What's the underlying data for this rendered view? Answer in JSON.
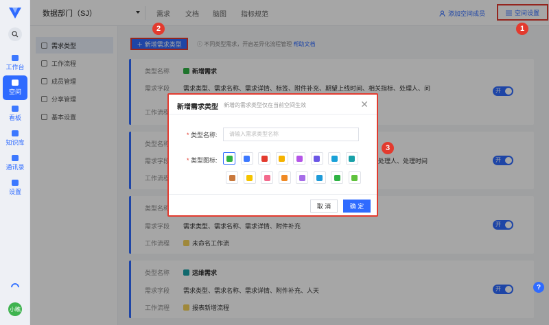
{
  "rail": {
    "items": [
      {
        "label": "工作台"
      },
      {
        "label": "空间"
      },
      {
        "label": "看板"
      },
      {
        "label": "知识库"
      },
      {
        "label": "通讯录"
      },
      {
        "label": "设置"
      }
    ],
    "avatar_text": "小瞧"
  },
  "header": {
    "department": "数据部门（SJ）",
    "tabs": [
      "需求",
      "文档",
      "脑图",
      "指标规范"
    ],
    "add_member": "添加空间成员",
    "space_settings": "空间设置"
  },
  "subnav": {
    "items": [
      "需求类型",
      "工作流程",
      "成员管理",
      "分享管理",
      "基本设置"
    ]
  },
  "toolbar": {
    "new_type_button": "新增需求类型",
    "hint": "不同类型需求，开启差异化流程管理",
    "help_link": "帮助文档"
  },
  "labels": {
    "type_name": "类型名称",
    "fields": "需求字段",
    "workflow": "工作流程",
    "toggle_on": "开"
  },
  "cards": [
    {
      "name": "新增需求",
      "fields": "需求类型、需求名称、需求详情、标签、附件补充、期望上线时间、相关指标、处理人、问",
      "workflow": "",
      "icon_color": "#2fb344"
    },
    {
      "name": "",
      "fields": "处理人、处理时间",
      "workflow": "",
      "icon_color": "#3c78ff"
    },
    {
      "name": "",
      "fields": "需求类型、需求名称、需求详情、附件补充",
      "workflow": "未命名工作流",
      "icon_color": "#f5b300"
    },
    {
      "name": "运维需求",
      "fields": "需求类型、需求名称、需求详情、附件补充、人天",
      "workflow": "报表新增流程",
      "icon_color": "#19a1a8"
    }
  ],
  "modal": {
    "title": "新增需求类型",
    "subtitle": "新增的需求类型仅在当前空间生效",
    "name_label": "类型名称:",
    "name_placeholder": "请输入需求类型名称",
    "icon_label": "类型图标:",
    "required_mark": "*",
    "cancel": "取 消",
    "confirm": "确 定",
    "icon_colors": [
      "#2fb344",
      "#3c78ff",
      "#e33a2e",
      "#f5b300",
      "#b455e8",
      "#6b57e6",
      "#19a1d8",
      "#19a1a8",
      "#c9793d",
      "#f5c400",
      "#f36a8d",
      "#f08a24",
      "#a66de8",
      "#1f9bd8",
      "#2fb344",
      "#5fc23c"
    ]
  },
  "markers": [
    "1",
    "2",
    "3"
  ],
  "help": "?"
}
